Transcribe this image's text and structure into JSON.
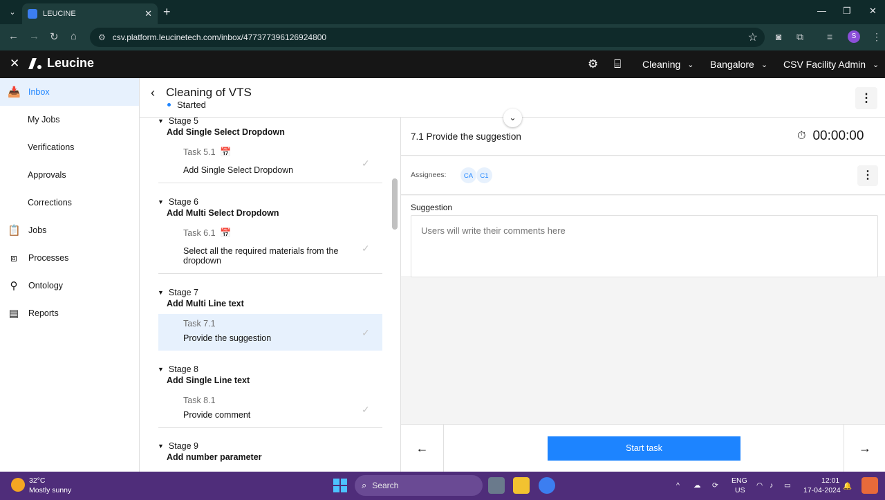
{
  "browser": {
    "tab_title": "LEUCINE",
    "url": "csv.platform.leucinetech.com/inbox/477377396126924800",
    "profile_initial": "S"
  },
  "app": {
    "brand": "Leucine",
    "header": {
      "use_case": "Cleaning",
      "facility": "Bangalore",
      "user": "CSV Facility Admin"
    },
    "sidebar": [
      {
        "label": "Inbox",
        "icon": "inbox-icon",
        "active": true
      },
      {
        "label": "My Jobs"
      },
      {
        "label": "Verifications"
      },
      {
        "label": "Approvals"
      },
      {
        "label": "Corrections"
      },
      {
        "label": "Jobs",
        "icon": "clipboard-icon"
      },
      {
        "label": "Processes",
        "icon": "process-icon"
      },
      {
        "label": "Ontology",
        "icon": "hierarchy-icon"
      },
      {
        "label": "Reports",
        "icon": "report-icon"
      }
    ],
    "job": {
      "title": "Cleaning of VTS",
      "state": "Started"
    },
    "stages": [
      {
        "number": "Stage 5",
        "name": "Add Single Select Dropdown",
        "task_number": "Task 5.1",
        "task_name": "Add Single Select Dropdown"
      },
      {
        "number": "Stage 6",
        "name": "Add Multi Select Dropdown",
        "task_number": "Task 6.1",
        "task_name": "Select all the required materials from the dropdown"
      },
      {
        "number": "Stage 7",
        "name": "Add Multi Line text",
        "task_number": "Task 7.1",
        "task_name": "Provide the suggestion"
      },
      {
        "number": "Stage 8",
        "name": "Add Single Line text",
        "task_number": "Task 8.1",
        "task_name": "Provide comment"
      },
      {
        "number": "Stage 9",
        "name": "Add number parameter"
      }
    ],
    "task_panel": {
      "title": "7.1 Provide the suggestion",
      "timer": "00:00:00",
      "assignees_label": "Assignees:",
      "assignees": [
        "CA",
        "C1"
      ],
      "parameter_label": "Suggestion",
      "parameter_placeholder": "Users will write their comments here",
      "start_button": "Start task"
    }
  },
  "taskbar": {
    "temperature": "32°C",
    "weather": "Mostly sunny",
    "search": "Search",
    "lang": "ENG",
    "region": "US",
    "time": "12:01",
    "date": "17-04-2024"
  },
  "colors": {
    "accent": "#1d84ff",
    "header_bg": "#161616",
    "selected_bg": "#e7f1fd",
    "taskbar_bg": "#4f2d7a"
  }
}
